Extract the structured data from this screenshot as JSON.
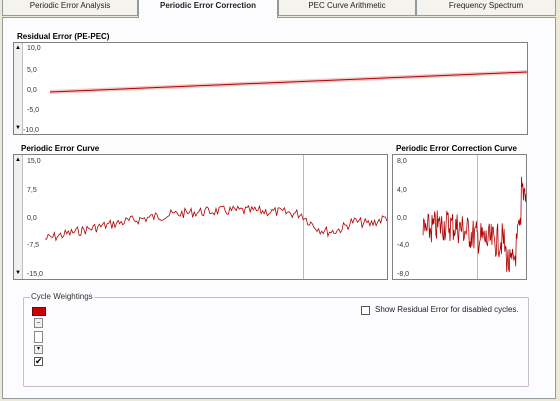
{
  "tabs": [
    {
      "label": "Periodic Error Analysis",
      "active": false
    },
    {
      "label": "Periodic Error Correction",
      "active": true
    },
    {
      "label": "PEC Curve Arithmetic",
      "active": false
    },
    {
      "label": "Frequency Spectrum",
      "active": false
    }
  ],
  "residual": {
    "title": "Residual Error (PE-PEC)",
    "ticks": [
      "10,0",
      "5,0",
      "0,0",
      "-5,0",
      "-10,0"
    ]
  },
  "pe_curve": {
    "title_prefix": "Periodic Error ",
    "title_bold": "Curve",
    "ticks": [
      "15,0",
      "7,5",
      "0,0",
      "-7,5",
      "-15,0"
    ]
  },
  "pec_curve": {
    "title": "Periodic Error Correction Curve",
    "ticks": [
      "8,0",
      "4,0",
      "0,0",
      "-4,0",
      "-8,0"
    ]
  },
  "cycle_weightings": {
    "label": "Cycle Weightings",
    "swatch_color": "#cc0000",
    "checked": true
  },
  "show_residual": {
    "label": "Show Residual Error for disabled cycles.",
    "checked": false
  },
  "colors": {
    "series": "#b00000",
    "residual_band": "#f5c8c8"
  }
}
